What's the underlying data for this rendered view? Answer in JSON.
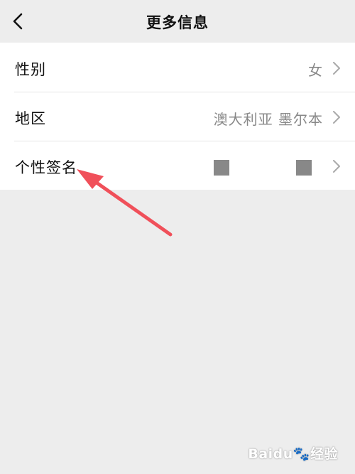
{
  "nav": {
    "title": "更多信息"
  },
  "rows": [
    {
      "label": "性别",
      "value": "女"
    },
    {
      "label": "地区",
      "value": "澳大利亚 墨尔本"
    },
    {
      "label": "个性签名",
      "value": ""
    }
  ],
  "annotation_color": "#f0505a",
  "watermark": {
    "brand": "Baidu",
    "paw_glyph": "🐾",
    "suffix": "经验"
  }
}
